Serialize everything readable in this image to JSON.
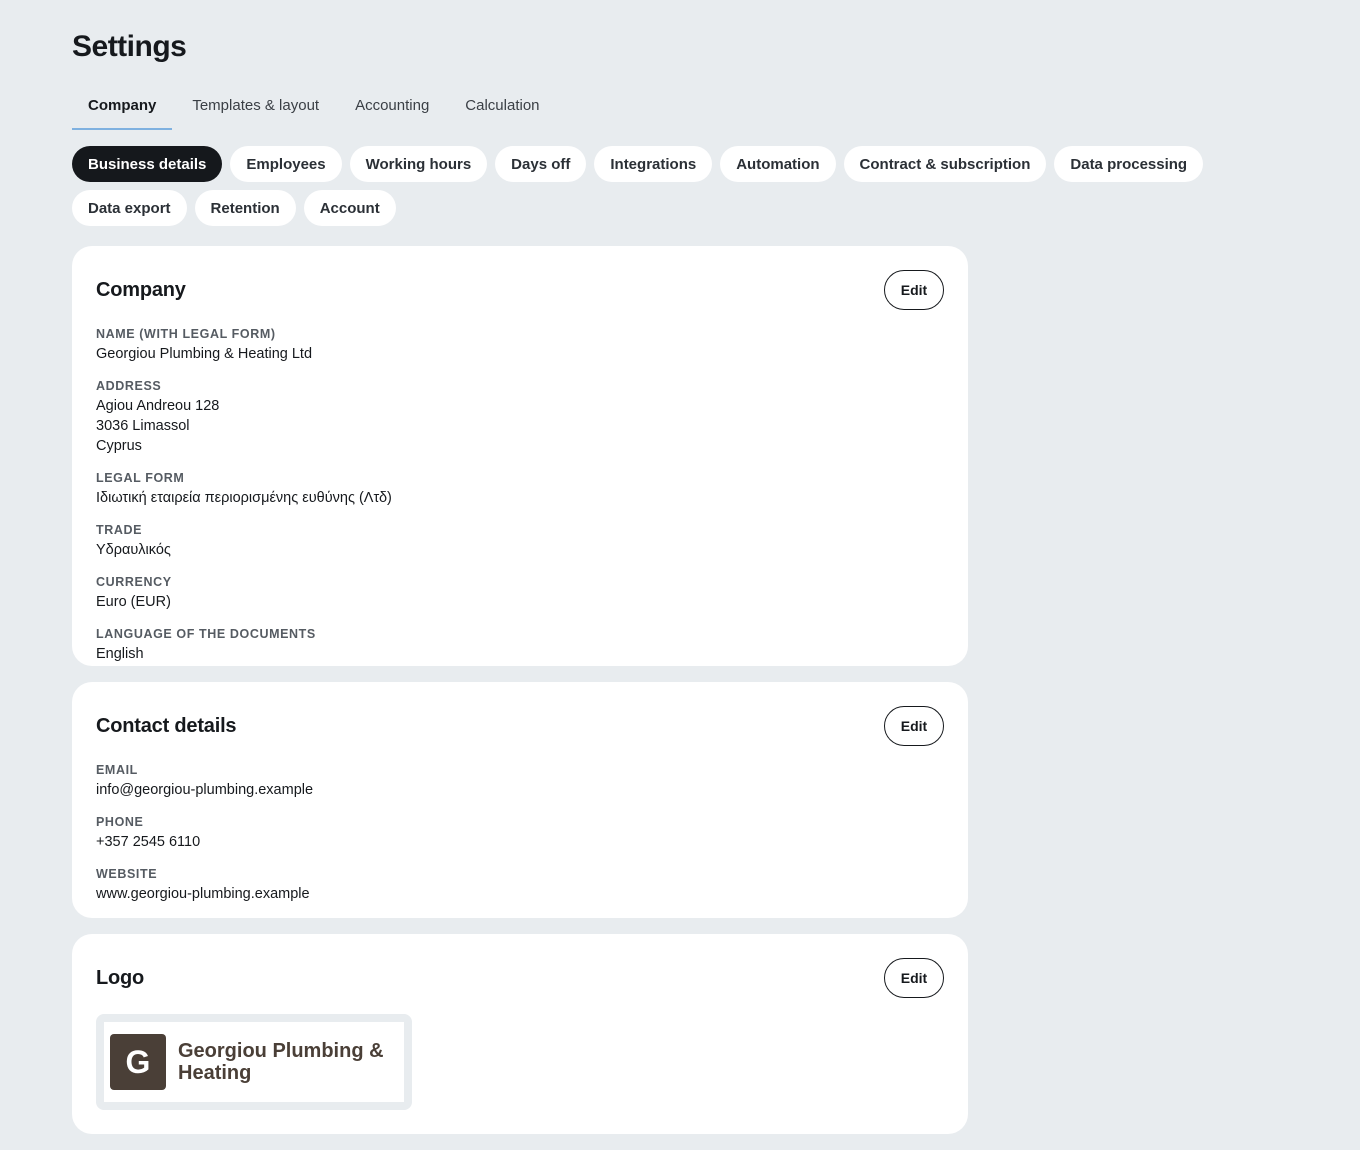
{
  "page": {
    "title": "Settings"
  },
  "tabs": [
    {
      "label": "Company",
      "active": true
    },
    {
      "label": "Templates & layout"
    },
    {
      "label": "Accounting"
    },
    {
      "label": "Calculation"
    }
  ],
  "subnav": [
    {
      "label": "Business details",
      "active": true
    },
    {
      "label": "Employees"
    },
    {
      "label": "Working hours"
    },
    {
      "label": "Days off"
    },
    {
      "label": "Integrations"
    },
    {
      "label": "Automation"
    },
    {
      "label": "Contract & subscription"
    },
    {
      "label": "Data processing"
    },
    {
      "label": "Data export"
    },
    {
      "label": "Retention"
    },
    {
      "label": "Account"
    }
  ],
  "company": {
    "title": "Company",
    "edit_label": "Edit",
    "name_label": "NAME (WITH LEGAL FORM)",
    "name_value": "Georgiou Plumbing & Heating Ltd",
    "address_label": "ADDRESS",
    "address_line1": "Agiou Andreou 128",
    "address_line2": "3036 Limassol",
    "address_line3": "Cyprus",
    "legal_form_label": "LEGAL FORM",
    "legal_form_value": "Ιδιωτική εταιρεία περιορισμένης ευθύνης (Λτδ)",
    "trade_label": "TRADE",
    "trade_value": "Υδραυλικός",
    "currency_label": "CURRENCY",
    "currency_value": "Euro (EUR)",
    "language_label": "LANGUAGE OF THE DOCUMENTS",
    "language_value": "English"
  },
  "contact": {
    "title": "Contact details",
    "edit_label": "Edit",
    "email_label": "EMAIL",
    "email_value": "info@georgiou-plumbing.example",
    "phone_label": "PHONE",
    "phone_value": "+357 2545 6110",
    "website_label": "WEBSITE",
    "website_value": "www.georgiou-plumbing.example"
  },
  "logo": {
    "title": "Logo",
    "edit_label": "Edit",
    "mark_letter": "G",
    "mark_color": "#4a3f37",
    "company_name": "Georgiou Plumbing & Heating"
  },
  "colors": {
    "background": "#e8ecef",
    "card": "#ffffff",
    "active_chip": "#15181c",
    "tab_underline": "#7fb1e0"
  }
}
